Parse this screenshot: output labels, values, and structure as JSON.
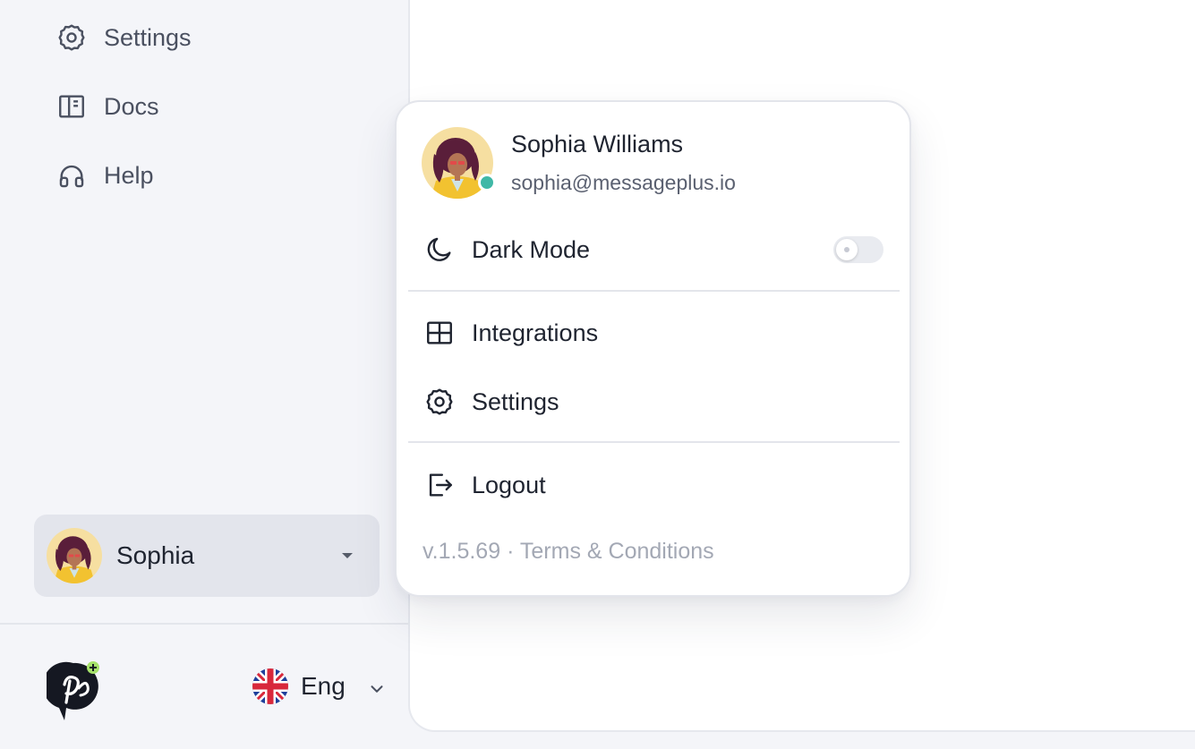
{
  "sidebar": {
    "items": [
      {
        "label": "Settings",
        "icon": "gear-icon"
      },
      {
        "label": "Docs",
        "icon": "book-icon"
      },
      {
        "label": "Help",
        "icon": "headphones-icon"
      }
    ],
    "user_button": {
      "name": "Sophia"
    },
    "language": {
      "label": "Eng",
      "icon": "uk-flag-icon"
    }
  },
  "profile_menu": {
    "name": "Sophia Williams",
    "email": "sophia@messageplus.io",
    "status_color": "#40b8a6",
    "dark_mode": {
      "label": "Dark Mode",
      "enabled": false
    },
    "items": [
      {
        "label": "Integrations",
        "icon": "grid-icon"
      },
      {
        "label": "Settings",
        "icon": "gear-icon"
      }
    ],
    "logout": {
      "label": "Logout",
      "icon": "logout-icon"
    },
    "footer": {
      "version": "v.1.5.69",
      "separator": "·",
      "terms": "Terms & Conditions"
    }
  }
}
